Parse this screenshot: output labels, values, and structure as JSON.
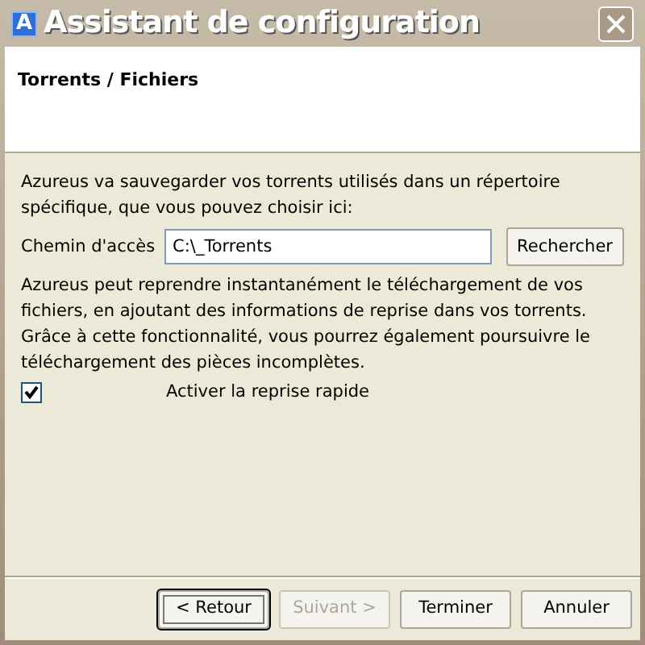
{
  "window": {
    "title": "Assistant de configuration",
    "icon": "A"
  },
  "header": {
    "title": "Torrents / Fichiers"
  },
  "intro": "Azureus va sauvegarder vos torrents utilisés dans un répertoire spécifique, que vous pouvez choisir ici:",
  "path": {
    "label": "Chemin d'accès",
    "value": "C:\\_Torrents",
    "button": "Rechercher"
  },
  "description": "Azureus peut reprendre instantanément le téléchargement de vos fichiers, en ajoutant des informations de reprise dans vos torrents. Grâce à cette fonctionnalité, vous pourrez également poursuivre le téléchargement des pièces incomplètes.",
  "option": {
    "label": "Activer la reprise rapide",
    "checked": true
  },
  "buttons": [
    {
      "label": "< Retour",
      "disabled": false,
      "focused": true
    },
    {
      "label": "Suivant >",
      "disabled": true,
      "focused": false
    },
    {
      "label": "Terminer",
      "disabled": false,
      "focused": false
    },
    {
      "label": "Annuler",
      "disabled": false,
      "focused": false
    }
  ]
}
